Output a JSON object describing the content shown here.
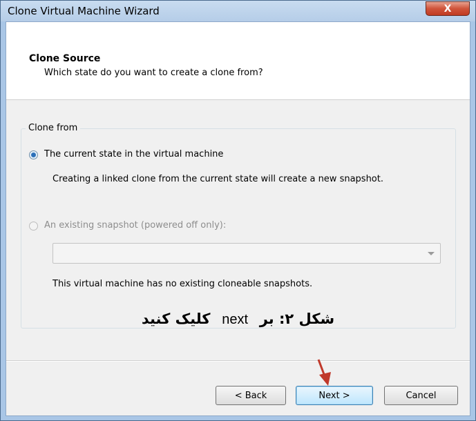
{
  "window": {
    "title": "Clone Virtual Machine Wizard",
    "close_label": "X"
  },
  "header": {
    "title": "Clone Source",
    "subtitle": "Which state do you want to create a clone from?"
  },
  "clone_from": {
    "group_label": "Clone from",
    "option_current": {
      "label": "The current state in the virtual machine",
      "selected": true,
      "description": "Creating a linked clone from the current state will create a new snapshot."
    },
    "option_snapshot": {
      "label": "An existing snapshot (powered off only):",
      "selected": false,
      "enabled": false,
      "combo_value": "",
      "note": "This virtual machine has no existing cloneable snapshots."
    }
  },
  "caption": {
    "part1": "شکل ۲: بر",
    "part2": "next",
    "part3": "کلیک کنید"
  },
  "buttons": {
    "back": "< Back",
    "next": "Next >",
    "cancel": "Cancel"
  },
  "colors": {
    "pointer_arrow": "#c0392b",
    "close_button": "#d0543a"
  }
}
